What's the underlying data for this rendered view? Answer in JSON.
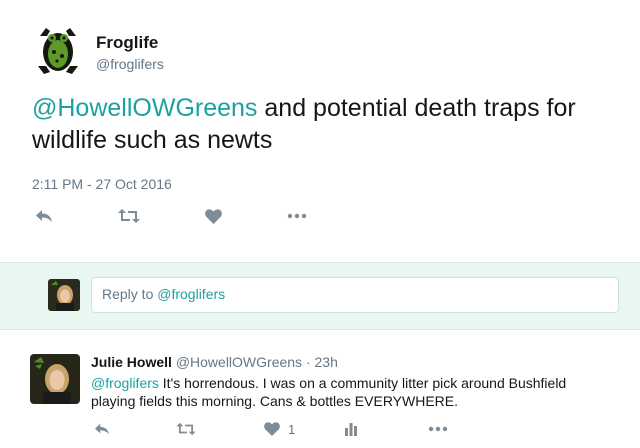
{
  "tweet": {
    "author_name": "Froglife",
    "author_handle": "@froglifers",
    "text_mention": "@HowellOWGreens",
    "text_body": " and potential death traps for wildlife such as newts",
    "timestamp": "2:11 PM - 27 Oct 2016",
    "actions": [
      "reply-icon",
      "retweet-icon",
      "heart-icon",
      "more-icon"
    ]
  },
  "reply_box": {
    "prefix": "Reply to ",
    "mention": "@froglifers"
  },
  "reply_tweet": {
    "author_name": "Julie Howell",
    "author_handle": "@HowellOWGreens",
    "time": "23h",
    "text_mention": "@froglifers",
    "text_body": " It's horrendous. I was on a community litter pick around Bushfield playing fields this morning. Cans & bottles EVERYWHERE.",
    "like_count": "1",
    "actions": [
      "reply-icon",
      "retweet-icon",
      "heart-icon",
      "analytics-icon",
      "more-icon"
    ]
  },
  "colors": {
    "accent": "#1da1a0",
    "icon": "#7f8c96",
    "reply_bar_bg": "#e9f7f2"
  }
}
